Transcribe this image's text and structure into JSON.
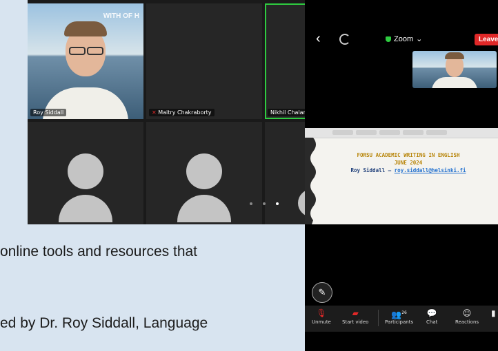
{
  "gallery": {
    "tiles": [
      {
        "name": "Roy Siddall",
        "watermark": "WITH OF H"
      },
      {
        "name": "Maitry Chakraborty"
      },
      {
        "name": "Nikhil Chalane"
      },
      {
        "name": ""
      },
      {
        "name": ""
      }
    ]
  },
  "phone": {
    "meeting_title": "Zoom",
    "leave_label": "Leave",
    "slide": {
      "line1": "FORSU ACADEMIC WRITING IN ENGLISH",
      "line2": "JUNE 2024",
      "line3_name": "Roy Siddall – ",
      "line3_email": "roy.siddall@helsinki.fi"
    },
    "toolbar": {
      "unmute": "Unmute",
      "start_video": "Start video",
      "participants": "Participants",
      "participants_count": "26",
      "chat": "Chat",
      "reactions": "Reactions"
    }
  },
  "document": {
    "line1": "online tools and resources that",
    "line2": "ed by Dr. Roy Siddall, Language"
  }
}
